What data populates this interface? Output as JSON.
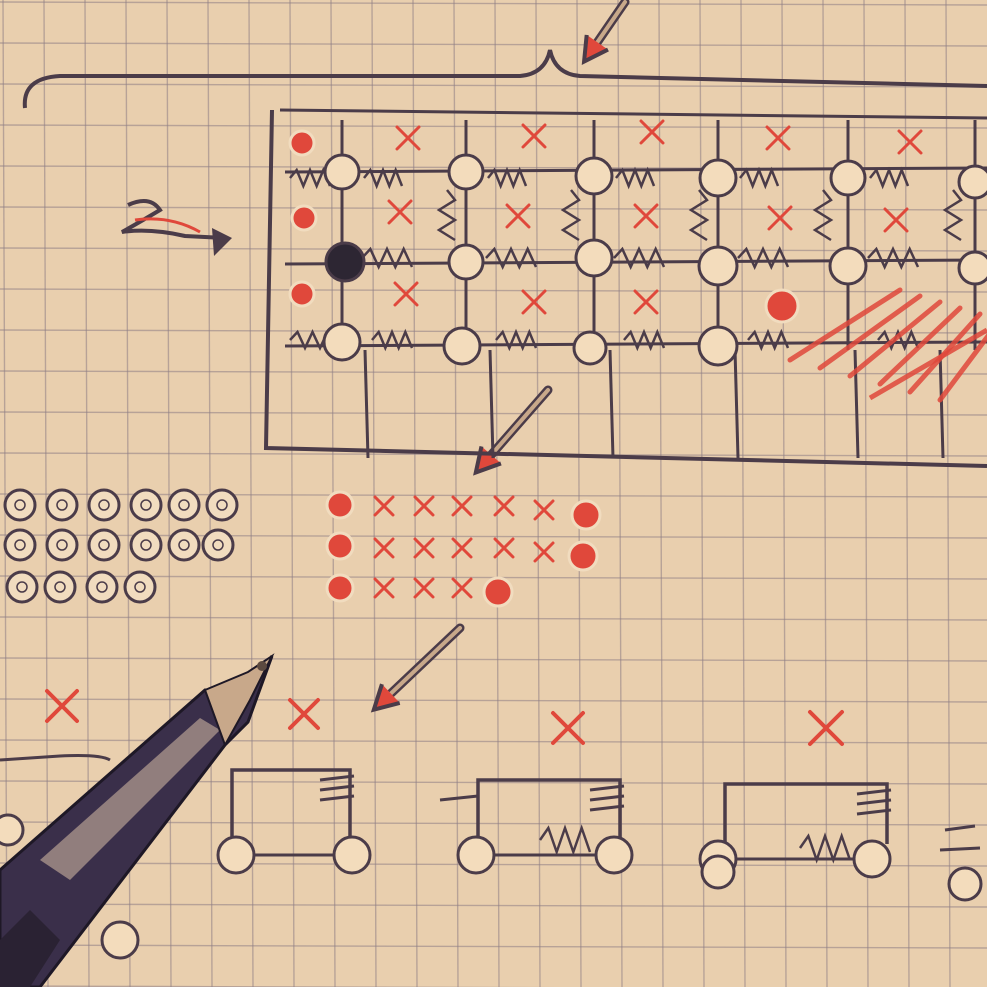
{
  "scene": {
    "subject": "hand-drawn-circuit-sketch-on-graph-paper",
    "colors": {
      "paper": "#e9cfae",
      "paper_light": "#f1dcbf",
      "grid": "#8f7f85",
      "ink": "#4b3c49",
      "red": "#e0483b",
      "node_fill": "#f3dcbc",
      "node_dark": "#2d2633",
      "pen_body": "#3a2f4a",
      "pen_highlight": "#d8c0a8",
      "pen_tip": "#c8a88a"
    },
    "icons": [
      "arrow-icon",
      "x-mark-icon",
      "node-icon",
      "resistor-icon",
      "ballpoint-pen"
    ]
  }
}
